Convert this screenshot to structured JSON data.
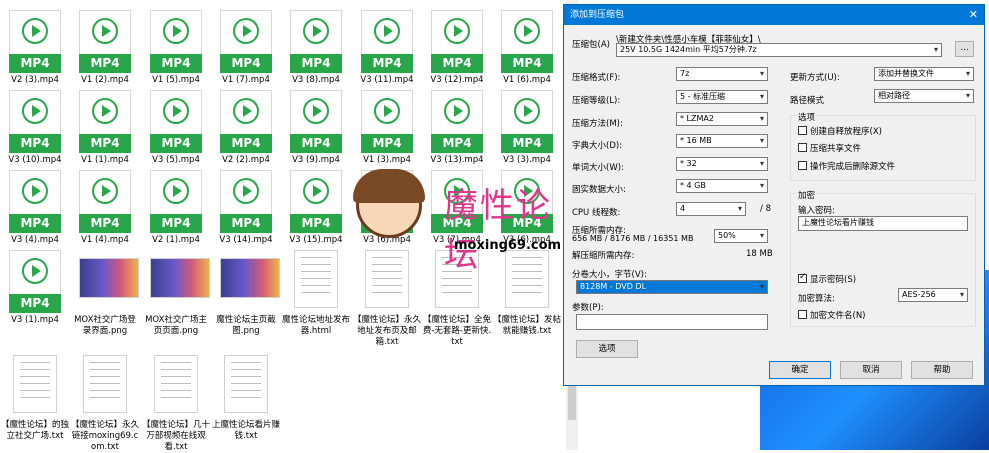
{
  "explorer": {
    "files": [
      {
        "name": "V2 (3).mp4",
        "type": "mp4"
      },
      {
        "name": "V1 (2).mp4",
        "type": "mp4"
      },
      {
        "name": "V1 (5).mp4",
        "type": "mp4"
      },
      {
        "name": "V1 (7).mp4",
        "type": "mp4"
      },
      {
        "name": "V3 (8).mp4",
        "type": "mp4"
      },
      {
        "name": "V3 (11).mp4",
        "type": "mp4"
      },
      {
        "name": "V3 (12).mp4",
        "type": "mp4"
      },
      {
        "name": "V1 (6).mp4",
        "type": "mp4"
      },
      {
        "name": "V3 (10).mp4",
        "type": "mp4"
      },
      {
        "name": "V1 (1).mp4",
        "type": "mp4"
      },
      {
        "name": "V3 (5).mp4",
        "type": "mp4"
      },
      {
        "name": "V2 (2).mp4",
        "type": "mp4"
      },
      {
        "name": "V3 (9).mp4",
        "type": "mp4"
      },
      {
        "name": "V1 (3).mp4",
        "type": "mp4"
      },
      {
        "name": "V3 (13).mp4",
        "type": "mp4"
      },
      {
        "name": "V3 (3).mp4",
        "type": "mp4"
      },
      {
        "name": "V3 (4).mp4",
        "type": "mp4"
      },
      {
        "name": "V1 (4).mp4",
        "type": "mp4"
      },
      {
        "name": "V2 (1).mp4",
        "type": "mp4"
      },
      {
        "name": "V3 (14).mp4",
        "type": "mp4"
      },
      {
        "name": "V3 (15).mp4",
        "type": "mp4"
      },
      {
        "name": "V3 (6).mp4",
        "type": "mp4"
      },
      {
        "name": "V3 (7).mp4",
        "type": "mp4"
      },
      {
        "name": "V3 (6).mp4",
        "type": "mp4"
      },
      {
        "name": "V3 (1).mp4",
        "type": "mp4"
      },
      {
        "name": "MOX社交广场登录界面.png",
        "type": "png"
      },
      {
        "name": "MOX社交广场主页页面.png",
        "type": "png"
      },
      {
        "name": "魔性论坛主页截图.png",
        "type": "png"
      },
      {
        "name": "魔性论坛地址发布器.html",
        "type": "doc"
      },
      {
        "name": "【魔性论坛】永久地址发布页及邮箱.txt",
        "type": "doc"
      },
      {
        "name": "【魔性论坛】全免费-无套路-更新快.txt",
        "type": "doc"
      },
      {
        "name": "【魔性论坛】发帖就能赚钱.txt",
        "type": "doc"
      },
      {
        "name": "【魔性论坛】的独立社交广场.txt",
        "type": "doc"
      },
      {
        "name": "【魔性论坛】永久链接moxing69.com.txt",
        "type": "doc"
      },
      {
        "name": "【魔性论坛】几十万部视频在线观看.txt",
        "type": "doc"
      },
      {
        "name": "上魔性论坛看片赚钱.txt",
        "type": "doc"
      }
    ],
    "mp4_badge": "MP4"
  },
  "dialog": {
    "title": "添加到压缩包",
    "close": "✕",
    "archive_label": "压缩包(A)",
    "archive_path": "\\新建文件夹\\性感小车模【菲菲仙女】\\",
    "archive_name": "25V 10.5G 1424min 平均57分钟.7z",
    "browse": "...",
    "format_label": "压缩格式(F):",
    "format_value": "7z",
    "level_label": "压缩等级(L):",
    "level_value": "5 - 标准压缩",
    "method_label": "压缩方法(M):",
    "method_value": "* LZMA2",
    "dict_label": "字典大小(D):",
    "dict_value": "* 16 MB",
    "word_label": "单词大小(W):",
    "word_value": "* 32",
    "solid_label": "固实数据大小:",
    "solid_value": "* 4 GB",
    "threads_label": "CPU 线程数:",
    "threads_value": "4",
    "threads_total": "/ 8",
    "mem_comp_label": "压缩所需内存:",
    "mem_comp_value": "656 MB / 8176 MB / 16351 MB",
    "mem_pct": "50%",
    "mem_decomp_label": "解压缩所需内存:",
    "mem_decomp_value": "18 MB",
    "split_label": "分卷大小，字节(V):",
    "split_value": "8128M - DVD DL",
    "params_label": "参数(P):",
    "options_button": "选项",
    "update_label": "更新方式(U):",
    "update_value": "添加并替换文件",
    "pathmode_label": "路径模式",
    "pathmode_value": "相对路径",
    "options_group": "选项",
    "opt_sfx": "创建自释放程序(X)",
    "opt_shared": "压缩共享文件",
    "opt_delete": "操作完成后删除源文件",
    "encrypt_group": "加密",
    "password_label": "输入密码:",
    "password_value": "上魔性论坛看片赚钱",
    "show_password": "显示密码(S)",
    "enc_method_label": "加密算法:",
    "enc_method_value": "AES-256",
    "enc_names": "加密文件名(N)",
    "ok": "确定",
    "cancel": "取消",
    "help": "帮助"
  },
  "watermark": {
    "text": "魔性论坛",
    "site": "moxing69.com"
  }
}
